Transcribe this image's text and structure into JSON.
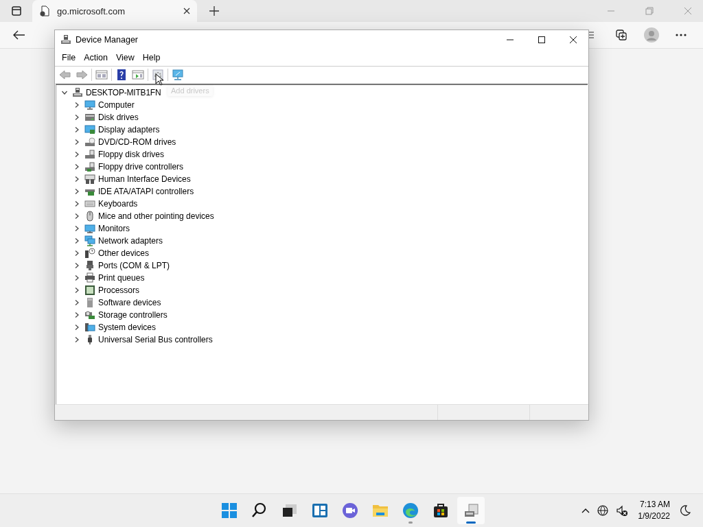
{
  "browser": {
    "tab": {
      "title": "go.microsoft.com",
      "selected": true
    }
  },
  "window": {
    "title": "Device Manager"
  },
  "menu": [
    "File",
    "Action",
    "View",
    "Help"
  ],
  "toolbar": {
    "tooltip": "Add drivers"
  },
  "tree": {
    "label": "DESKTOP-MITB1FN",
    "expanded": true,
    "children": [
      {
        "label": "Computer",
        "expanded": false
      },
      {
        "label": "Disk drives",
        "expanded": false
      },
      {
        "label": "Display adapters",
        "expanded": false
      },
      {
        "label": "DVD/CD-ROM drives",
        "expanded": false
      },
      {
        "label": "Floppy disk drives",
        "expanded": false
      },
      {
        "label": "Floppy drive controllers",
        "expanded": false
      },
      {
        "label": "Human Interface Devices",
        "expanded": false
      },
      {
        "label": "IDE ATA/ATAPI controllers",
        "expanded": false
      },
      {
        "label": "Keyboards",
        "expanded": false
      },
      {
        "label": "Mice and other pointing devices",
        "expanded": false
      },
      {
        "label": "Monitors",
        "expanded": false
      },
      {
        "label": "Network adapters",
        "expanded": false
      },
      {
        "label": "Other devices",
        "expanded": false
      },
      {
        "label": "Ports (COM & LPT)",
        "expanded": false
      },
      {
        "label": "Print queues",
        "expanded": false
      },
      {
        "label": "Processors",
        "expanded": false
      },
      {
        "label": "Software devices",
        "expanded": false
      },
      {
        "label": "Storage controllers",
        "expanded": false
      },
      {
        "label": "System devices",
        "expanded": false
      },
      {
        "label": "Universal Serial Bus controllers",
        "expanded": false
      }
    ]
  },
  "taskbar": {
    "apps": [
      {
        "selected": false,
        "running": false
      },
      {
        "selected": false,
        "running": false
      },
      {
        "selected": false,
        "running": false
      },
      {
        "selected": false,
        "running": false
      },
      {
        "selected": false,
        "running": false
      },
      {
        "selected": false,
        "running": false
      },
      {
        "selected": false,
        "running": true
      },
      {
        "selected": false,
        "running": false
      },
      {
        "selected": true,
        "running": true
      }
    ],
    "time": "7:13 AM",
    "date": "1/9/2022"
  }
}
